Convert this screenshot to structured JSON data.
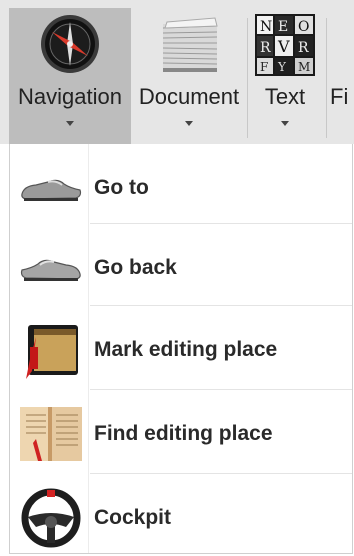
{
  "ribbon": {
    "buttons": [
      {
        "label": "Navigation",
        "icon": "compass-icon",
        "active": true
      },
      {
        "label": "Document",
        "icon": "paper-stack-icon"
      },
      {
        "label": "Text",
        "icon": "letters-icon"
      },
      {
        "label": "Fi",
        "icon": ""
      }
    ]
  },
  "menu": {
    "items": [
      {
        "label": "Go to",
        "icon": "shoe-icon"
      },
      {
        "label": "Go back",
        "icon": "shoe-back-icon"
      },
      {
        "label": "Mark editing place",
        "icon": "book-bookmark-icon"
      },
      {
        "label": "Find editing place",
        "icon": "open-book-icon"
      },
      {
        "label": "Cockpit",
        "icon": "steering-wheel-icon"
      }
    ]
  },
  "colors": {
    "ribbon_bg": "#e6e6e6",
    "active_bg": "#bdbdbd",
    "menu_text": "#2a2a2a"
  }
}
